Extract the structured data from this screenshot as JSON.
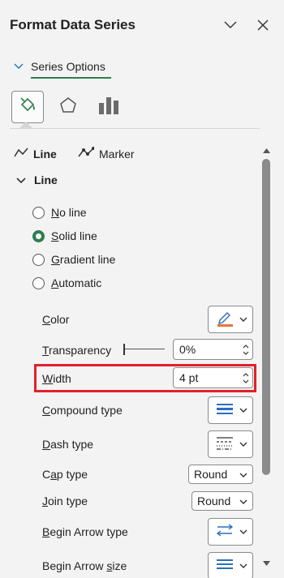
{
  "pane": {
    "title": "Format Data Series"
  },
  "tabs": {
    "series_options": "Series Options"
  },
  "subtabs": {
    "line": "Line",
    "marker": "Marker"
  },
  "section": {
    "title": "Line"
  },
  "radios": [
    {
      "key": "N",
      "rest": "o line",
      "checked": false
    },
    {
      "key": "S",
      "rest": "olid line",
      "checked": true
    },
    {
      "key": "G",
      "rest": "radient line",
      "checked": false
    },
    {
      "key": "A",
      "rest": "utomatic",
      "checked": false
    }
  ],
  "props": {
    "color": {
      "key": "C",
      "rest": "olor"
    },
    "transparency": {
      "key": "T",
      "rest": "ransparency",
      "value": "0%"
    },
    "width": {
      "key": "W",
      "rest": "idth",
      "value": "4 pt"
    },
    "compound": {
      "key": "C",
      "rest": "ompound type"
    },
    "dash": {
      "key": "D",
      "rest": "ash type"
    },
    "cap": {
      "pre": "C",
      "key": "a",
      "rest": "p type",
      "value": "Round"
    },
    "join": {
      "key": "J",
      "rest": "oin type",
      "value": "Round"
    },
    "begin_arrow_type": {
      "key": "B",
      "rest": "egin Arrow type"
    },
    "begin_arrow_size": {
      "pre": "Begin Arrow ",
      "key": "s",
      "rest": "ize"
    }
  },
  "colors": {
    "accent_green": "#2e7d4f",
    "highlight_red": "#e3202a",
    "line_color_swatch": "#e9733a",
    "icon_blue": "#2a6fbf"
  }
}
